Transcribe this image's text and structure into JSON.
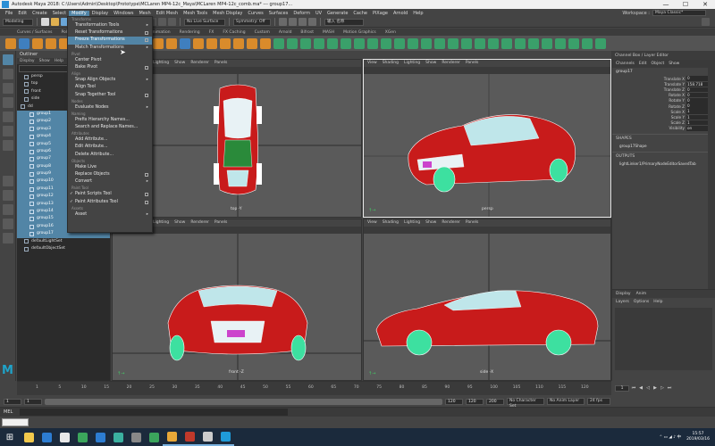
{
  "window": {
    "title": "Autodesk Maya 2018: C:\\Users\\Admin\\Desktop\\Prototype\\MCLaren MP4-12c_Maya\\MCLaren MP4-12c_comb.ma*   ---   group17...",
    "controls": [
      "—",
      "☐",
      "✕"
    ]
  },
  "menubar": {
    "items": [
      "File",
      "Edit",
      "Create",
      "Select",
      "Modify",
      "Display",
      "Windows",
      "Mesh",
      "Edit Mesh",
      "Mesh Tools",
      "Mesh Display",
      "Curves",
      "Surfaces",
      "Deform",
      "UV",
      "Generate",
      "Cache",
      "PiXage",
      "Arnold",
      "Help"
    ],
    "active_index": 4,
    "workspace_label": "Workspace :",
    "workspace_value": "Maya Classic*"
  },
  "statusline": {
    "mode": "Modeling",
    "live_surface": "No Live Surface",
    "symmetry": "Symmetry: Off",
    "input_label": "输入 名称"
  },
  "shelf": {
    "tabs": [
      "Curves / Surfaces",
      "Poly Modeling",
      "Sculpting",
      "Rigging",
      "Animation",
      "Rendering",
      "FX",
      "FX Caching",
      "Custom",
      "Arnold",
      "Bifrost",
      "MASH",
      "Motion Graphics",
      "XGen"
    ],
    "active_index": 3,
    "icon_colors": [
      "#d98b2b",
      "#3f7fbf",
      "#d98b2b",
      "#d98b2b",
      "#d98b2b",
      "#d98b2b",
      "#d98b2b",
      "#d98b2b",
      "#d98b2b",
      "#d98b2b",
      "#d98b2b",
      "#d98b2b",
      "#d98b2b",
      "#3f7fbf",
      "#d98b2b",
      "#d98b2b",
      "#d98b2b",
      "#d98b2b",
      "#d98b2b",
      "#d98b2b",
      "#3aa06a",
      "#3aa06a",
      "#3aa06a",
      "#3aa06a",
      "#3aa06a",
      "#3aa06a",
      "#3aa06a",
      "#3aa06a",
      "#3aa06a",
      "#3aa06a",
      "#3aa06a",
      "#3aa06a",
      "#3aa06a",
      "#3aa06a",
      "#3aa06a",
      "#3aa06a",
      "#3aa06a",
      "#3aa06a",
      "#3aa06a",
      "#3aa06a",
      "#3aa06a",
      "#3aa06a",
      "#3aa06a",
      "#3aa06a",
      "#3aa06a"
    ]
  },
  "outliner": {
    "title": "Outliner",
    "menu": [
      "Display",
      "Show",
      "Help"
    ],
    "items": [
      {
        "label": "persp",
        "selected": false,
        "indent": 8
      },
      {
        "label": "top",
        "selected": false,
        "indent": 8
      },
      {
        "label": "front",
        "selected": false,
        "indent": 8
      },
      {
        "label": "side",
        "selected": false,
        "indent": 8
      },
      {
        "label": "dd",
        "selected": false,
        "indent": 4
      },
      {
        "label": "group1",
        "selected": true,
        "indent": 14
      },
      {
        "label": "group2",
        "selected": true,
        "indent": 14
      },
      {
        "label": "group3",
        "selected": true,
        "indent": 14
      },
      {
        "label": "group4",
        "selected": true,
        "indent": 14
      },
      {
        "label": "group5",
        "selected": true,
        "indent": 14
      },
      {
        "label": "group6",
        "selected": true,
        "indent": 14
      },
      {
        "label": "group7",
        "selected": true,
        "indent": 14
      },
      {
        "label": "group8",
        "selected": true,
        "indent": 14
      },
      {
        "label": "group9",
        "selected": true,
        "indent": 14
      },
      {
        "label": "group10",
        "selected": true,
        "indent": 14
      },
      {
        "label": "group11",
        "selected": true,
        "indent": 14
      },
      {
        "label": "group12",
        "selected": true,
        "indent": 14
      },
      {
        "label": "group13",
        "selected": true,
        "indent": 14
      },
      {
        "label": "group14",
        "selected": true,
        "indent": 14
      },
      {
        "label": "group15",
        "selected": true,
        "indent": 14
      },
      {
        "label": "group16",
        "selected": true,
        "indent": 14
      },
      {
        "label": "group17",
        "selected": true,
        "indent": 14
      },
      {
        "label": "defaultLightSet",
        "selected": false,
        "indent": 8
      },
      {
        "label": "defaultObjectSet",
        "selected": false,
        "indent": 8
      }
    ]
  },
  "dropdown": {
    "sections": [
      {
        "header": "Transforms",
        "items": [
          {
            "label": "Transformation Tools",
            "arrow": true
          },
          {
            "label": "Reset Transformations",
            "opt": true
          },
          {
            "label": "Freeze Transformations",
            "opt": true,
            "highlight": true
          },
          {
            "label": "Match Transformations",
            "arrow": true
          }
        ]
      },
      {
        "header": "Pivot",
        "items": [
          {
            "label": "Center Pivot"
          },
          {
            "label": "Bake Pivot",
            "opt": true
          }
        ]
      },
      {
        "header": "Align",
        "items": [
          {
            "label": "Snap Align Objects",
            "arrow": true
          },
          {
            "label": "Align Tool"
          },
          {
            "label": "Snap Together Tool",
            "opt": true
          }
        ]
      },
      {
        "header": "Nodes",
        "items": [
          {
            "label": "Evaluate Nodes",
            "arrow": true
          }
        ]
      },
      {
        "header": "Naming",
        "items": [
          {
            "label": "Prefix Hierarchy Names..."
          },
          {
            "label": "Search and Replace Names..."
          }
        ]
      },
      {
        "header": "Attributes",
        "items": [
          {
            "label": "Add Attribute..."
          },
          {
            "label": "Edit Attribute..."
          },
          {
            "label": "Delete Attribute..."
          }
        ]
      },
      {
        "header": "Objects",
        "items": [
          {
            "label": "Make Live"
          },
          {
            "label": "Replace Objects",
            "opt": true
          }
        ]
      },
      {
        "header": "",
        "items": [
          {
            "label": "Convert",
            "arrow": true
          }
        ]
      },
      {
        "header": "Paint Tool",
        "items": [
          {
            "label": "Paint Scripts Tool",
            "opt": true,
            "check": true
          },
          {
            "label": "Paint Attributes Tool",
            "opt": true,
            "check": true
          }
        ]
      },
      {
        "header": "Assets",
        "items": [
          {
            "label": "Asset",
            "arrow": true
          }
        ]
      }
    ]
  },
  "viewports": {
    "menu": [
      "View",
      "Shading",
      "Lighting",
      "Show",
      "Renderer",
      "Panels"
    ],
    "top_label": "top -Y",
    "persp_label": "persp",
    "front_label": "front -Z",
    "side_label": "side -X"
  },
  "channelbox": {
    "tabs": [
      "Channel Box / Layer Editor"
    ],
    "menu": [
      "Channels",
      "Edit",
      "Object",
      "Show"
    ],
    "object": "group17",
    "attributes": [
      {
        "name": "Translate X",
        "value": "0"
      },
      {
        "name": "Translate Y",
        "value": "158.718"
      },
      {
        "name": "Translate Z",
        "value": "0"
      },
      {
        "name": "Rotate X",
        "value": "0"
      },
      {
        "name": "Rotate Y",
        "value": "0"
      },
      {
        "name": "Rotate Z",
        "value": "0"
      },
      {
        "name": "Scale X",
        "value": "1"
      },
      {
        "name": "Scale Y",
        "value": "1"
      },
      {
        "name": "Scale Z",
        "value": "1"
      },
      {
        "name": "Visibility",
        "value": "on"
      }
    ],
    "shapes_header": "SHAPES",
    "shapes_node": "group17Shape",
    "outputs_header": "OUTPUTS",
    "outputs_node": "lightLinker1/PrimaryNodeEditorSavedTab"
  },
  "layer": {
    "tabs": [
      "Display",
      "Anim"
    ],
    "menu": [
      "Layers",
      "Options",
      "Help"
    ]
  },
  "timeslider": {
    "ticks": [
      "1",
      "5",
      "10",
      "15",
      "20",
      "25",
      "30",
      "35",
      "40",
      "45",
      "50",
      "55",
      "60",
      "65",
      "70",
      "75",
      "80",
      "85",
      "90",
      "95",
      "100",
      "105",
      "110",
      "115",
      "120"
    ],
    "current_frame": "1"
  },
  "range": {
    "start": "1",
    "start2": "1",
    "end": "120",
    "end2": "120",
    "end3": "200",
    "character_set": "No Character Set",
    "anim_layer": "No Anim Layer",
    "fps": "24 fps"
  },
  "cmdline": {
    "language": "MEL"
  },
  "taskbar": {
    "time": "15:57",
    "date": "2019/03/16",
    "apps": [
      {
        "color": "#f2c94c",
        "open": false
      },
      {
        "color": "#2d7dd2",
        "open": false
      },
      {
        "color": "#e8e8e8",
        "open": false
      },
      {
        "color": "#3ba55c",
        "open": false
      },
      {
        "color": "#2d7dd2",
        "open": false
      },
      {
        "color": "#3bb0a0",
        "open": false
      },
      {
        "color": "#888888",
        "open": false
      },
      {
        "color": "#3ba55c",
        "open": false
      },
      {
        "color": "#e8a838",
        "open": true
      },
      {
        "color": "#c0392b",
        "open": true
      },
      {
        "color": "#cccccc",
        "open": true
      },
      {
        "color": "#1f9bd8",
        "open": true
      }
    ]
  }
}
